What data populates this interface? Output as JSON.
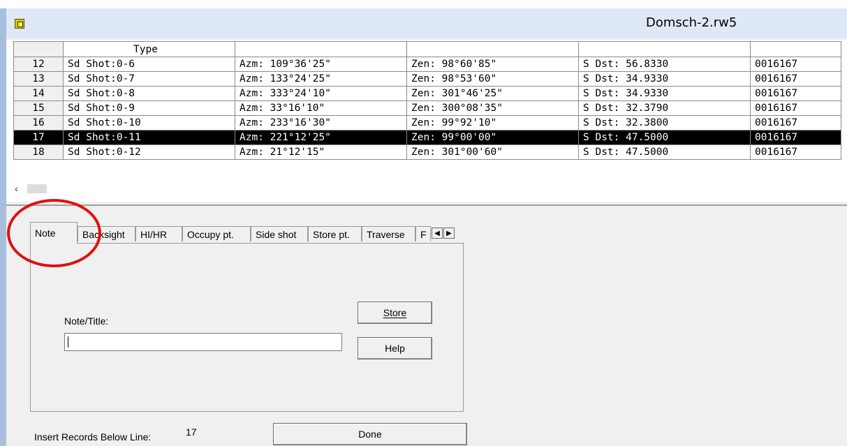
{
  "window": {
    "title": "Domsch-2.rw5"
  },
  "grid": {
    "headers": [
      "",
      "Type",
      "",
      "",
      "",
      ""
    ],
    "rows": [
      {
        "num": "12",
        "type": "Sd Shot:0-6",
        "azm": "Azm: 109°36'25\"",
        "zen": "Zen: 98°60'85\"",
        "dst": "S Dst: 56.8330",
        "code": "0016167"
      },
      {
        "num": "13",
        "type": "Sd Shot:0-7",
        "azm": "Azm: 133°24'25\"",
        "zen": "Zen: 98°53'60\"",
        "dst": "S Dst: 34.9330",
        "code": "0016167"
      },
      {
        "num": "14",
        "type": "Sd Shot:0-8",
        "azm": "Azm: 333°24'10\"",
        "zen": "Zen: 301°46'25\"",
        "dst": "S Dst: 34.9330",
        "code": "0016167"
      },
      {
        "num": "15",
        "type": "Sd Shot:0-9",
        "azm": "Azm: 33°16'10\"",
        "zen": "Zen: 300°08'35\"",
        "dst": "S Dst: 32.3790",
        "code": "0016167"
      },
      {
        "num": "16",
        "type": "Sd Shot:0-10",
        "azm": "Azm: 233°16'30\"",
        "zen": "Zen: 99°92'10\"",
        "dst": "S Dst: 32.3800",
        "code": "0016167"
      },
      {
        "num": "17",
        "type": "Sd Shot:0-11",
        "azm": "Azm: 221°12'25\"",
        "zen": "Zen: 99°00'00\"",
        "dst": "S Dst: 47.5000",
        "code": "0016167"
      },
      {
        "num": "18",
        "type": "Sd Shot:0-12",
        "azm": "Azm: 21°12'15\"",
        "zen": "Zen: 301°00'60\"",
        "dst": "S Dst: 47.5000",
        "code": "0016167"
      }
    ],
    "selected_row": "17",
    "scroll_left_icon": "‹"
  },
  "tabs": [
    {
      "label": "Note",
      "active": true
    },
    {
      "label": "Backsight",
      "active": false
    },
    {
      "label": "HI/HR",
      "active": false
    },
    {
      "label": "Occupy pt.",
      "active": false
    },
    {
      "label": "Side shot",
      "active": false
    },
    {
      "label": "Store pt.",
      "active": false
    },
    {
      "label": "Traverse",
      "active": false
    },
    {
      "label": "F",
      "active": false
    }
  ],
  "tab_scroll": {
    "left_icon": "◀",
    "right_icon": "▶"
  },
  "note": {
    "label": "Note/Title:",
    "value": ""
  },
  "buttons": {
    "store": "Store",
    "help": "Help",
    "done": "Done"
  },
  "insert": {
    "label": "Insert Records Below Line:",
    "value": "17"
  },
  "colors": {
    "annotation": "#e01010",
    "selected_row_bg": "#000000",
    "title_bar": "#dfe9f5"
  }
}
